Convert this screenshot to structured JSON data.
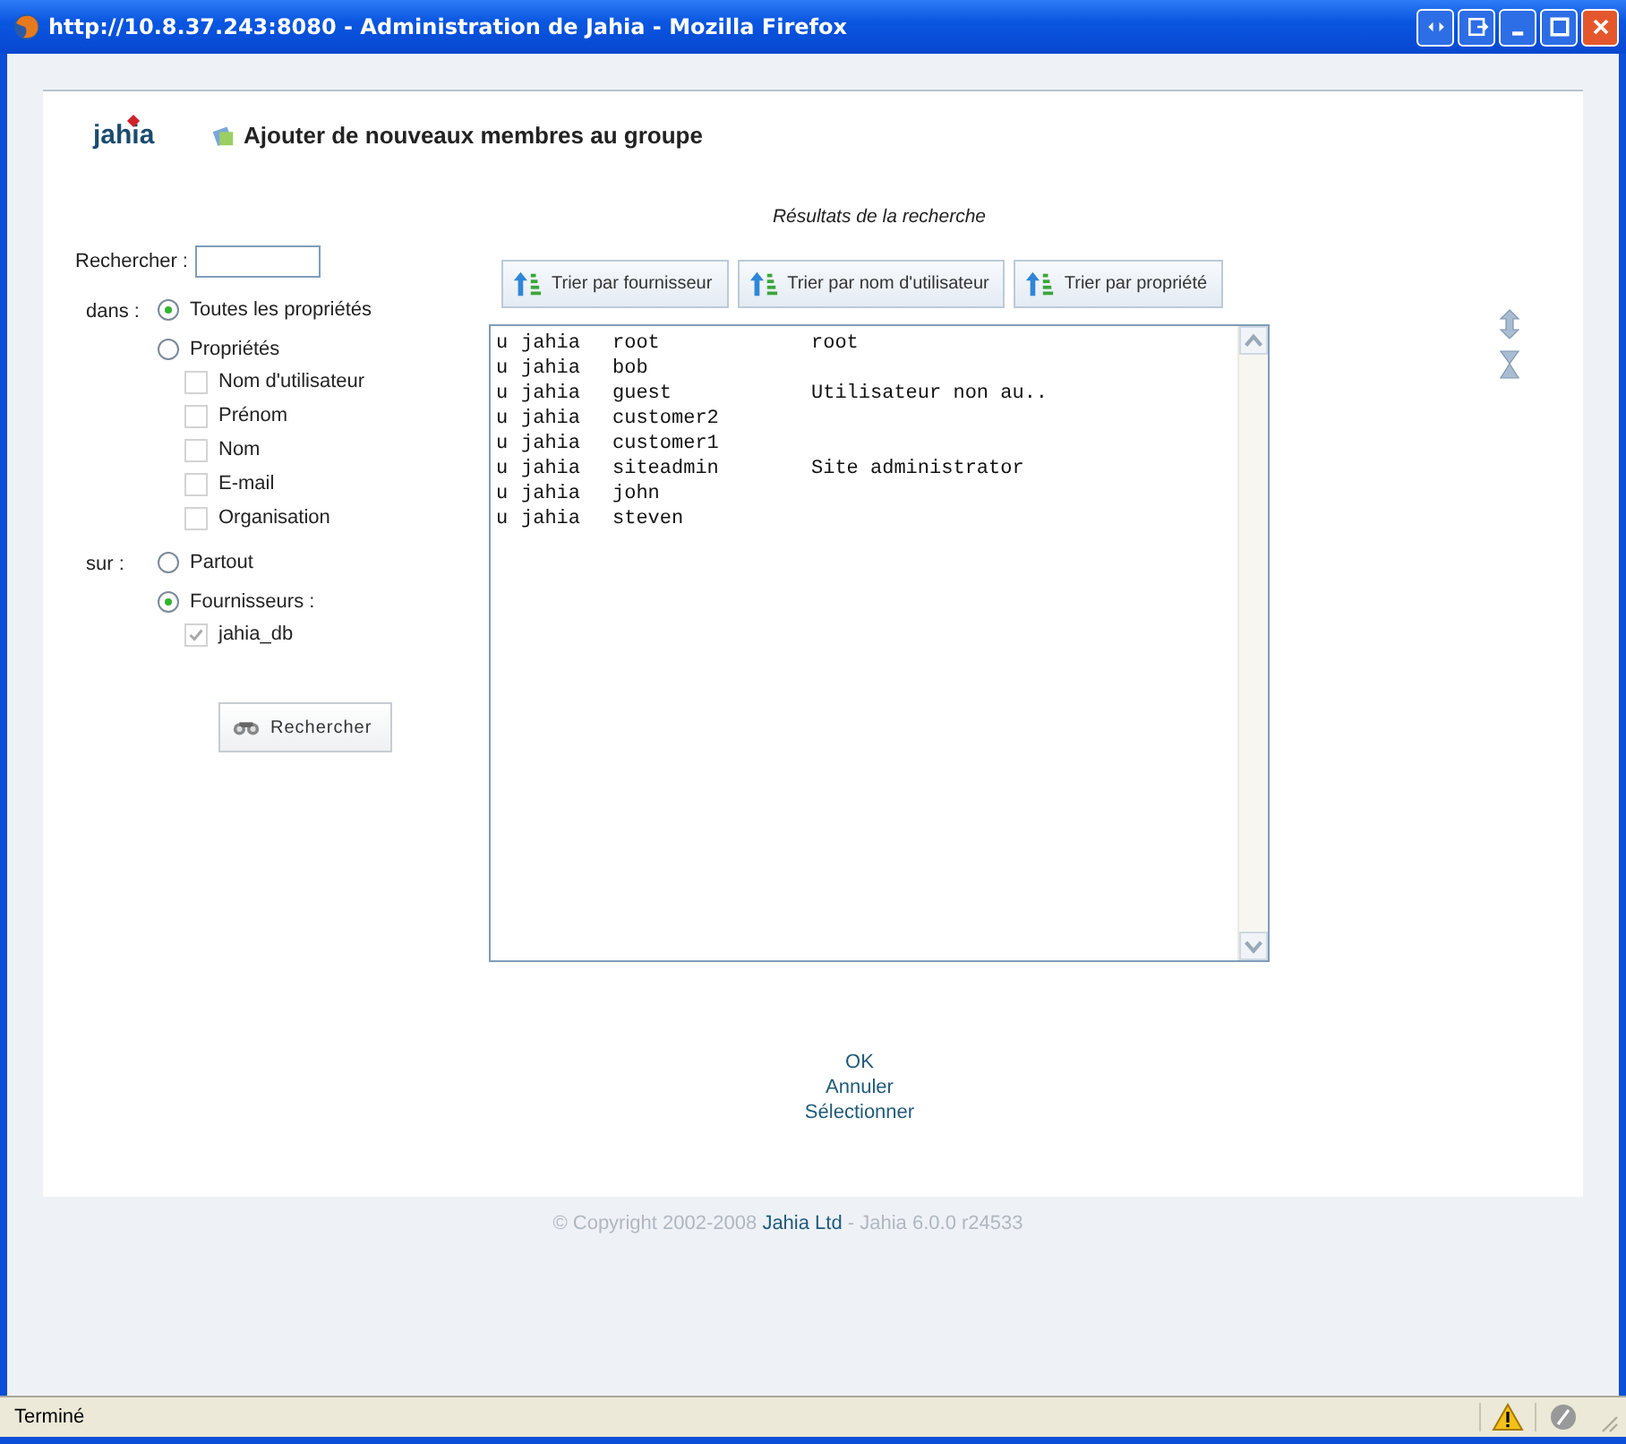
{
  "window": {
    "title": "http://10.8.37.243:8080 - Administration de Jahia - Mozilla Firefox"
  },
  "header": {
    "logo": "jahia",
    "title": "Ajouter de nouveaux membres au groupe"
  },
  "search": {
    "label": "Rechercher :"
  },
  "scope": [
    {
      "label": "dans :",
      "options": [
        {
          "label": "Toutes les propriétés",
          "selected": true
        },
        {
          "label": "Propriétés",
          "selected": false,
          "checkboxes": [
            {
              "label": "Nom d'utilisateur",
              "checked": false
            },
            {
              "label": "Prénom",
              "checked": false
            },
            {
              "label": "Nom",
              "checked": false
            },
            {
              "label": "E-mail",
              "checked": false
            },
            {
              "label": "Organisation",
              "checked": false
            }
          ]
        }
      ]
    },
    {
      "label": "sur :",
      "options": [
        {
          "label": "Partout",
          "selected": false
        },
        {
          "label": "Fournisseurs :",
          "selected": true,
          "checkboxes": [
            {
              "label": "jahia_db",
              "checked": true
            }
          ]
        }
      ]
    }
  ],
  "search_button": "Rechercher",
  "results": {
    "title": "Résultats de la recherche",
    "sort_buttons": [
      "Trier par fournisseur",
      "Trier par nom d'utilisateur",
      "Trier par propriété"
    ],
    "rows": [
      {
        "type": "u",
        "provider": "jahia",
        "name": "root",
        "description": "root"
      },
      {
        "type": "u",
        "provider": "jahia",
        "name": "bob"
      },
      {
        "type": "u",
        "provider": "jahia",
        "name": "guest",
        "description": "Utilisateur non au.."
      },
      {
        "type": "u",
        "provider": "jahia",
        "name": "customer2"
      },
      {
        "type": "u",
        "provider": "jahia",
        "name": "customer1"
      },
      {
        "type": "u",
        "provider": "jahia",
        "name": "siteadmin",
        "description": "Site administrator"
      },
      {
        "type": "u",
        "provider": "jahia",
        "name": "john"
      },
      {
        "type": "u",
        "provider": "jahia",
        "name": "steven"
      }
    ]
  },
  "actions": [
    "OK",
    "Annuler",
    "Sélectionner"
  ],
  "footer": {
    "copyright": "© Copyright 2002-2008",
    "company": "Jahia Ltd",
    "version": "- Jahia 6.0.0 r24533"
  },
  "status_bar": {
    "text": "Terminé"
  }
}
